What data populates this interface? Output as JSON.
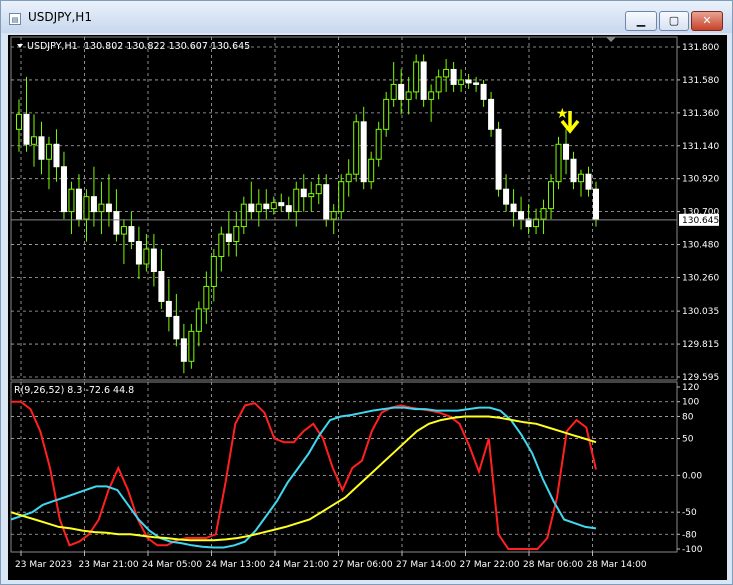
{
  "window": {
    "title": "USDJPY,H1",
    "icon_name": "chart-window-icon",
    "buttons": [
      "minimize-icon",
      "maximize-icon",
      "close-icon"
    ]
  },
  "chart_header": {
    "symbol_line": "USDJPY,H1",
    "ohlc": "130.802 130.822 130.607 130.645",
    "dropdown_icon": "triangle-down-icon"
  },
  "indicator_header": "R(9,26,52) 8.3 -72.6 44.8",
  "current_price_label": "130.645",
  "colors": {
    "background": "#000000",
    "candles": "#ffffff",
    "wicks": "#7cfc00",
    "grid": "#b0b0b0",
    "line1": "#ff2020",
    "line2": "#40d8f0",
    "line3": "#ffff20",
    "arrow": "#ffff00"
  },
  "chart_data": [
    {
      "type": "candlestick",
      "title": "USDJPY,H1",
      "y_ticks": [
        "131.800",
        "131.580",
        "131.360",
        "131.140",
        "130.920",
        "130.700",
        "130.480",
        "130.260",
        "130.035",
        "129.815",
        "129.595"
      ],
      "ylim": [
        129.595,
        131.8
      ],
      "last_price": 130.645,
      "x_labels": [
        "23 Mar 2023",
        "23 Mar 21:00",
        "24 Mar 05:00",
        "24 Mar 13:00",
        "24 Mar 21:00",
        "27 Mar 06:00",
        "27 Mar 14:00",
        "27 Mar 22:00",
        "28 Mar 06:00",
        "28 Mar 14:00"
      ],
      "candles": [
        [
          131.25,
          131.45,
          131.1,
          131.35
        ],
        [
          131.35,
          131.6,
          131.1,
          131.15
        ],
        [
          131.15,
          131.35,
          131.0,
          131.2
        ],
        [
          131.2,
          131.3,
          130.95,
          131.05
        ],
        [
          131.05,
          131.2,
          130.85,
          131.15
        ],
        [
          131.15,
          131.25,
          130.9,
          131.0
        ],
        [
          131.0,
          131.1,
          130.65,
          130.7
        ],
        [
          130.7,
          130.9,
          130.55,
          130.85
        ],
        [
          130.85,
          130.95,
          130.6,
          130.65
        ],
        [
          130.65,
          130.85,
          130.5,
          130.8
        ],
        [
          130.8,
          131.0,
          130.6,
          130.7
        ],
        [
          130.7,
          130.9,
          130.55,
          130.75
        ],
        [
          130.75,
          130.95,
          130.6,
          130.7
        ],
        [
          130.7,
          130.85,
          130.5,
          130.55
        ],
        [
          130.55,
          130.65,
          130.35,
          130.6
        ],
        [
          130.6,
          130.7,
          130.45,
          130.5
        ],
        [
          130.5,
          130.6,
          130.25,
          130.35
        ],
        [
          130.35,
          130.55,
          130.3,
          130.45
        ],
        [
          130.45,
          130.55,
          130.2,
          130.3
        ],
        [
          130.3,
          130.45,
          130.05,
          130.1
        ],
        [
          130.1,
          130.25,
          129.9,
          130.0
        ],
        [
          130.0,
          130.15,
          129.8,
          129.85
        ],
        [
          129.85,
          129.95,
          129.62,
          129.7
        ],
        [
          129.7,
          129.95,
          129.65,
          129.9
        ],
        [
          129.9,
          130.1,
          129.8,
          130.05
        ],
        [
          130.05,
          130.3,
          129.95,
          130.2
        ],
        [
          130.2,
          130.45,
          130.1,
          130.4
        ],
        [
          130.4,
          130.6,
          130.3,
          130.55
        ],
        [
          130.55,
          130.7,
          130.4,
          130.5
        ],
        [
          130.5,
          130.7,
          130.4,
          130.6
        ],
        [
          130.6,
          130.8,
          130.55,
          130.75
        ],
        [
          130.75,
          130.9,
          130.65,
          130.7
        ],
        [
          130.7,
          130.85,
          130.6,
          130.75
        ],
        [
          130.75,
          130.85,
          130.65,
          130.72
        ],
        [
          130.72,
          130.8,
          130.68,
          130.76
        ],
        [
          130.76,
          130.82,
          130.7,
          130.74
        ],
        [
          130.74,
          130.8,
          130.65,
          130.7
        ],
        [
          130.7,
          130.9,
          130.6,
          130.85
        ],
        [
          130.85,
          130.95,
          130.7,
          130.8
        ],
        [
          130.8,
          130.9,
          130.7,
          130.82
        ],
        [
          130.82,
          130.95,
          130.75,
          130.88
        ],
        [
          130.88,
          130.95,
          130.6,
          130.65
        ],
        [
          130.65,
          130.75,
          130.55,
          130.7
        ],
        [
          130.7,
          130.95,
          130.65,
          130.9
        ],
        [
          130.9,
          131.05,
          130.8,
          130.95
        ],
        [
          130.95,
          131.35,
          130.9,
          131.3
        ],
        [
          131.3,
          131.4,
          130.85,
          130.9
        ],
        [
          130.9,
          131.1,
          130.85,
          131.05
        ],
        [
          131.05,
          131.3,
          131.0,
          131.25
        ],
        [
          131.25,
          131.5,
          131.2,
          131.45
        ],
        [
          131.45,
          131.7,
          131.4,
          131.55
        ],
        [
          131.55,
          131.65,
          131.35,
          131.45
        ],
        [
          131.45,
          131.6,
          131.35,
          131.5
        ],
        [
          131.5,
          131.75,
          131.45,
          131.7
        ],
        [
          131.7,
          131.75,
          131.4,
          131.45
        ],
        [
          131.45,
          131.55,
          131.3,
          131.5
        ],
        [
          131.5,
          131.65,
          131.45,
          131.6
        ],
        [
          131.6,
          131.72,
          131.5,
          131.65
        ],
        [
          131.65,
          131.7,
          131.5,
          131.55
        ],
        [
          131.55,
          131.65,
          131.5,
          131.58
        ],
        [
          131.58,
          131.62,
          131.52,
          131.56
        ],
        [
          131.56,
          131.6,
          131.5,
          131.55
        ],
        [
          131.55,
          131.58,
          131.4,
          131.45
        ],
        [
          131.45,
          131.5,
          131.2,
          131.25
        ],
        [
          131.25,
          131.3,
          130.8,
          130.85
        ],
        [
          130.85,
          130.95,
          130.7,
          130.75
        ],
        [
          130.75,
          130.85,
          130.6,
          130.7
        ],
        [
          130.7,
          130.8,
          130.58,
          130.65
        ],
        [
          130.65,
          130.75,
          130.55,
          130.6
        ],
        [
          130.6,
          130.72,
          130.55,
          130.65
        ],
        [
          130.65,
          130.78,
          130.55,
          130.72
        ],
        [
          130.72,
          130.95,
          130.65,
          130.9
        ],
        [
          130.9,
          131.2,
          130.85,
          131.15
        ],
        [
          131.15,
          131.25,
          130.95,
          131.05
        ],
        [
          131.05,
          131.1,
          130.85,
          130.9
        ],
        [
          130.9,
          130.98,
          130.8,
          130.95
        ],
        [
          130.95,
          131.0,
          130.8,
          130.85
        ],
        [
          130.85,
          130.9,
          130.6,
          130.65
        ]
      ]
    },
    {
      "type": "line",
      "title": "R(9,26,52) 8.3 -72.6 44.8",
      "y_ticks": [
        "120",
        "100",
        "80",
        "50",
        "0.00",
        "-50",
        "-80",
        "-100"
      ],
      "ylim": [
        -100,
        120
      ],
      "series": [
        {
          "values": [
            100,
            100,
            90,
            60,
            10,
            -60,
            -95,
            -90,
            -80,
            -60,
            -20,
            10,
            -20,
            -60,
            -85,
            -95,
            -95,
            -88,
            -85,
            -85,
            -85,
            -80,
            -10,
            70,
            95,
            98,
            85,
            50,
            45,
            45,
            60,
            70,
            50,
            10,
            -20,
            10,
            20,
            60,
            85,
            92,
            95,
            92,
            90,
            88,
            85,
            80,
            70,
            40,
            5,
            50,
            -80,
            -100,
            -100,
            -100,
            -100,
            -85,
            -30,
            60,
            75,
            65,
            8
          ]
        },
        {
          "values": [
            -60,
            -55,
            -50,
            -40,
            -35,
            -30,
            -25,
            -20,
            -15,
            -15,
            -20,
            -40,
            -60,
            -75,
            -85,
            -90,
            -92,
            -95,
            -97,
            -98,
            -98,
            -95,
            -90,
            -75,
            -55,
            -35,
            -10,
            10,
            30,
            55,
            75,
            80,
            82,
            85,
            88,
            90,
            92,
            92,
            90,
            90,
            88,
            88,
            88,
            90,
            92,
            92,
            88,
            75,
            55,
            30,
            -5,
            -35,
            -60,
            -65,
            -70,
            -72
          ]
        },
        {
          "values": [
            -50,
            -55,
            -60,
            -65,
            -70,
            -72,
            -75,
            -77,
            -78,
            -80,
            -80,
            -82,
            -84,
            -85,
            -87,
            -88,
            -88,
            -88,
            -87,
            -85,
            -82,
            -78,
            -74,
            -70,
            -65,
            -60,
            -50,
            -40,
            -30,
            -15,
            0,
            15,
            30,
            45,
            60,
            70,
            75,
            78,
            80,
            80,
            80,
            78,
            75,
            72,
            70,
            65,
            60,
            55,
            50,
            45
          ]
        }
      ]
    }
  ]
}
